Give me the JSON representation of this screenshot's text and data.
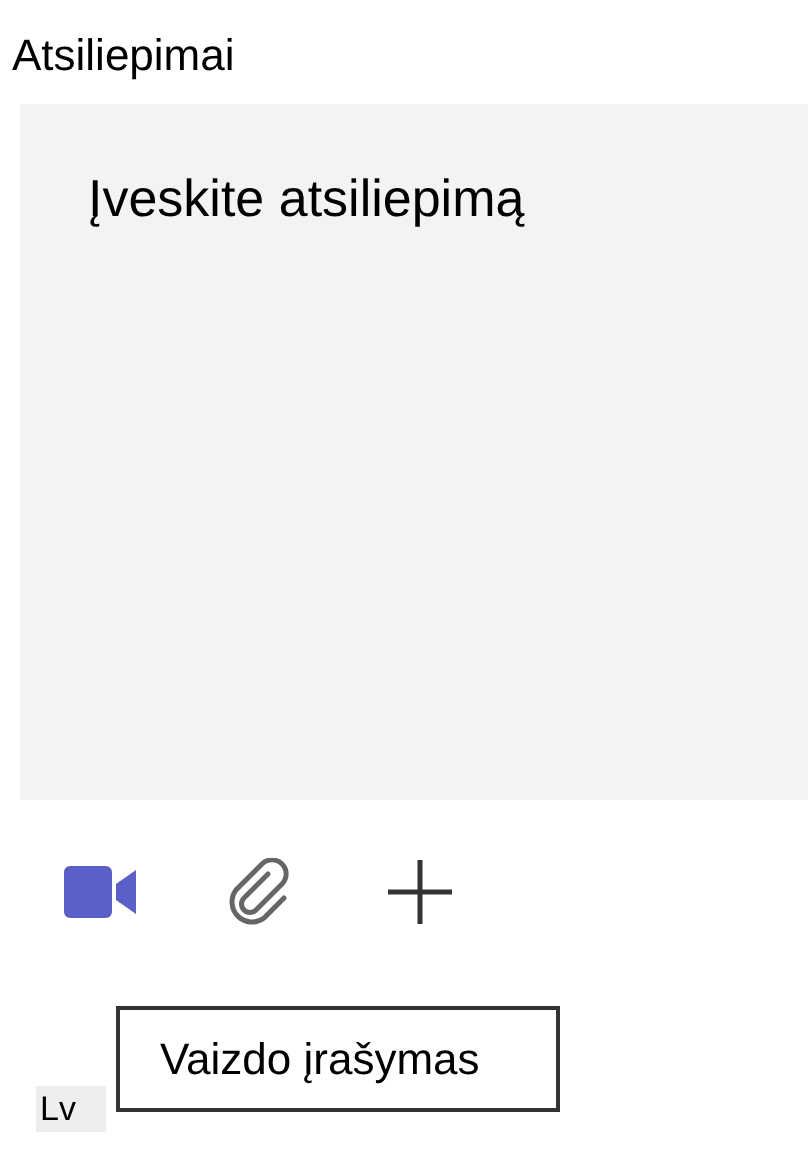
{
  "feedback": {
    "label": "Atsiliepimai",
    "placeholder": "Įveskite atsiliepimą"
  },
  "toolbar": [
    {
      "kind": "video"
    },
    {
      "kind": "attach"
    },
    {
      "kind": "add"
    }
  ],
  "tooltip": {
    "text": "Vaizdo įrašymas"
  },
  "badge": {
    "text": "Lv"
  }
}
